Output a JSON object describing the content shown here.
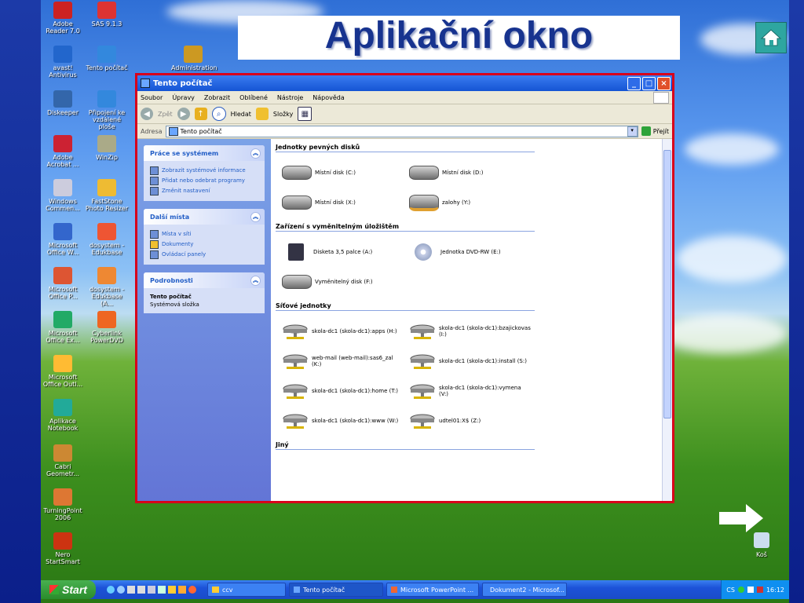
{
  "slide": {
    "title": "Aplikační okno",
    "colors": {
      "background": "#1c3aa8",
      "title": "#17338f",
      "window_border": "#d8001a"
    }
  },
  "desktop_icons": [
    {
      "label": "Adobe Reader 7.0",
      "icon": "adobe-reader-icon"
    },
    {
      "label": "SAS 9.1.3",
      "icon": "sas-icon"
    },
    {
      "label": "avast! Antivirus",
      "icon": "avast-icon"
    },
    {
      "label": "Tento počítač",
      "icon": "computer-icon"
    },
    {
      "label": "Administration",
      "icon": "admin-icon"
    },
    {
      "label": "Diskeeper",
      "icon": "diskeeper-icon"
    },
    {
      "label": "Připojení ke vzdálené ploše",
      "icon": "remote-desktop-icon"
    },
    {
      "label": "Adobe Acrobat ...",
      "icon": "acrobat-icon"
    },
    {
      "label": "WinZip",
      "icon": "winzip-icon"
    },
    {
      "label": "Windows Commen...",
      "icon": "window-icon"
    },
    {
      "label": "FastStone Photo Resizer",
      "icon": "folder-icon"
    },
    {
      "label": "Microsoft Office W...",
      "icon": "word-icon"
    },
    {
      "label": "dosystem - Edukbase",
      "icon": "k-icon"
    },
    {
      "label": "Microsoft Office P...",
      "icon": "powerpoint-icon"
    },
    {
      "label": "dosystem - Edukbase (A...",
      "icon": "a-icon"
    },
    {
      "label": "Microsoft Office Ex...",
      "icon": "excel-icon"
    },
    {
      "label": "Cyberlink PowerDVD",
      "icon": "dvd-icon"
    },
    {
      "label": "Microsoft Office Outl...",
      "icon": "outlook-icon"
    },
    {
      "label": "Aplikace Notebook",
      "icon": "notebook-icon"
    },
    {
      "label": "Cabri Geometr...",
      "icon": "cabri-icon"
    },
    {
      "label": "TurningPoint 2006",
      "icon": "turningpoint-icon"
    },
    {
      "label": "Nero StartSmart",
      "icon": "nero-icon"
    }
  ],
  "recycle_bin": {
    "label": "Koš"
  },
  "window": {
    "title": "Tento počítač",
    "menu": [
      "Soubor",
      "Úpravy",
      "Zobrazit",
      "Oblíbené",
      "Nástroje",
      "Nápověda"
    ],
    "toolbar": {
      "back": "Zpět",
      "search": "Hledat",
      "folders": "Složky"
    },
    "address_label": "Adresa",
    "address_value": "Tento počítač",
    "go_label": "Přejít",
    "panels": [
      {
        "title": "Práce se systémem",
        "items": [
          "Zobrazit systémové informace",
          "Přidat nebo odebrat programy",
          "Změnit nastavení"
        ]
      },
      {
        "title": "Další místa",
        "items": [
          "Místa v síti",
          "Dokumenty",
          "Ovládací panely"
        ]
      },
      {
        "title": "Podrobnosti",
        "detail_title": "Tento počítač",
        "detail_sub": "Systémová složka"
      }
    ],
    "sections": [
      {
        "title": "Jednotky pevných disků",
        "items": [
          {
            "label": "Místní disk (C:)",
            "icon": "hard-drive-icon"
          },
          {
            "label": "Místní disk (D:)",
            "icon": "hard-drive-icon"
          },
          {
            "label": "Místní disk (X:)",
            "icon": "hard-drive-icon"
          },
          {
            "label": "zalohy (Y:)",
            "icon": "shared-drive-icon"
          }
        ]
      },
      {
        "title": "Zařízení s vyměnitelným úložištěm",
        "items": [
          {
            "label": "Disketa 3,5 palce (A:)",
            "icon": "floppy-icon"
          },
          {
            "label": "Jednotka DVD-RW (E:)",
            "icon": "dvd-drive-icon"
          },
          {
            "label": "Vyměnitelný disk (F:)",
            "icon": "removable-drive-icon"
          }
        ]
      },
      {
        "title": "Síťové jednotky",
        "items": [
          {
            "label": "skola-dc1 (skola-dc1):apps (H:)",
            "icon": "network-drive-icon"
          },
          {
            "label": "skola-dc1 (skola-dc1):bzajickovas (I:)",
            "icon": "network-drive-icon"
          },
          {
            "label": "web-mail (web-mail):sas6_zal (K:)",
            "icon": "network-drive-icon"
          },
          {
            "label": "skola-dc1 (skola-dc1):install (S:)",
            "icon": "network-drive-icon"
          },
          {
            "label": "skola-dc1 (skola-dc1):home (T:)",
            "icon": "network-drive-icon"
          },
          {
            "label": "skola-dc1 (skola-dc1):vymena (V:)",
            "icon": "network-drive-icon"
          },
          {
            "label": "skola-dc1 (skola-dc1):www (W:)",
            "icon": "network-drive-icon"
          },
          {
            "label": "udtel01:X$ (Z:)",
            "icon": "network-drive-icon"
          }
        ]
      },
      {
        "title": "Jiný",
        "items": []
      }
    ]
  },
  "taskbar": {
    "start": "Start",
    "tasks": [
      "ccv",
      "Tento počítač",
      "Microsoft PowerPoint ...",
      "Dokument2 - Microsof..."
    ],
    "tray_lang": "CS",
    "clock": "16:12"
  }
}
